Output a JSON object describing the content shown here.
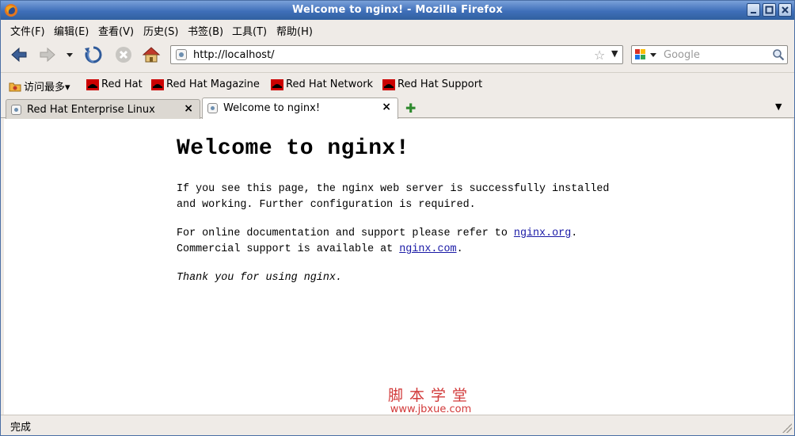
{
  "window": {
    "title": "Welcome to nginx! - Mozilla Firefox"
  },
  "menu": {
    "items": [
      "文件(F)",
      "编辑(E)",
      "查看(V)",
      "历史(S)",
      "书签(B)",
      "工具(T)",
      "帮助(H)"
    ]
  },
  "nav": {
    "url": "http://localhost/",
    "search_placeholder": "Google"
  },
  "bookmarks": {
    "items": [
      "访问最多▾",
      "Red Hat",
      "Red Hat Magazine",
      "Red Hat Network",
      "Red Hat Support"
    ]
  },
  "tabs": {
    "items": [
      {
        "label": "Red Hat Enterprise Linux"
      },
      {
        "label": "Welcome to nginx!"
      }
    ],
    "close_glyph": "×",
    "new_tab_glyph": "✚",
    "list_glyph": "▼"
  },
  "page": {
    "heading": "Welcome to nginx!",
    "para1": "If you see this page, the nginx web server is successfully installed and working. Further configuration is required.",
    "para2_prefix": "For online documentation and support please refer to ",
    "link_org": "nginx.org",
    "para2_mid": ".",
    "para2_line2": "Commercial support is available at ",
    "link_com": "nginx.com",
    "para2_end": ".",
    "thanks": "Thank you for using nginx."
  },
  "watermark": {
    "cn": "脚本学堂",
    "url": "www.jbxue.com"
  },
  "status": {
    "text": "完成"
  },
  "colors": {
    "titlebar": "#3f6fb9",
    "link": "#1a1aa6",
    "watermark": "#d23a3a",
    "redhat": "#cc0000"
  }
}
